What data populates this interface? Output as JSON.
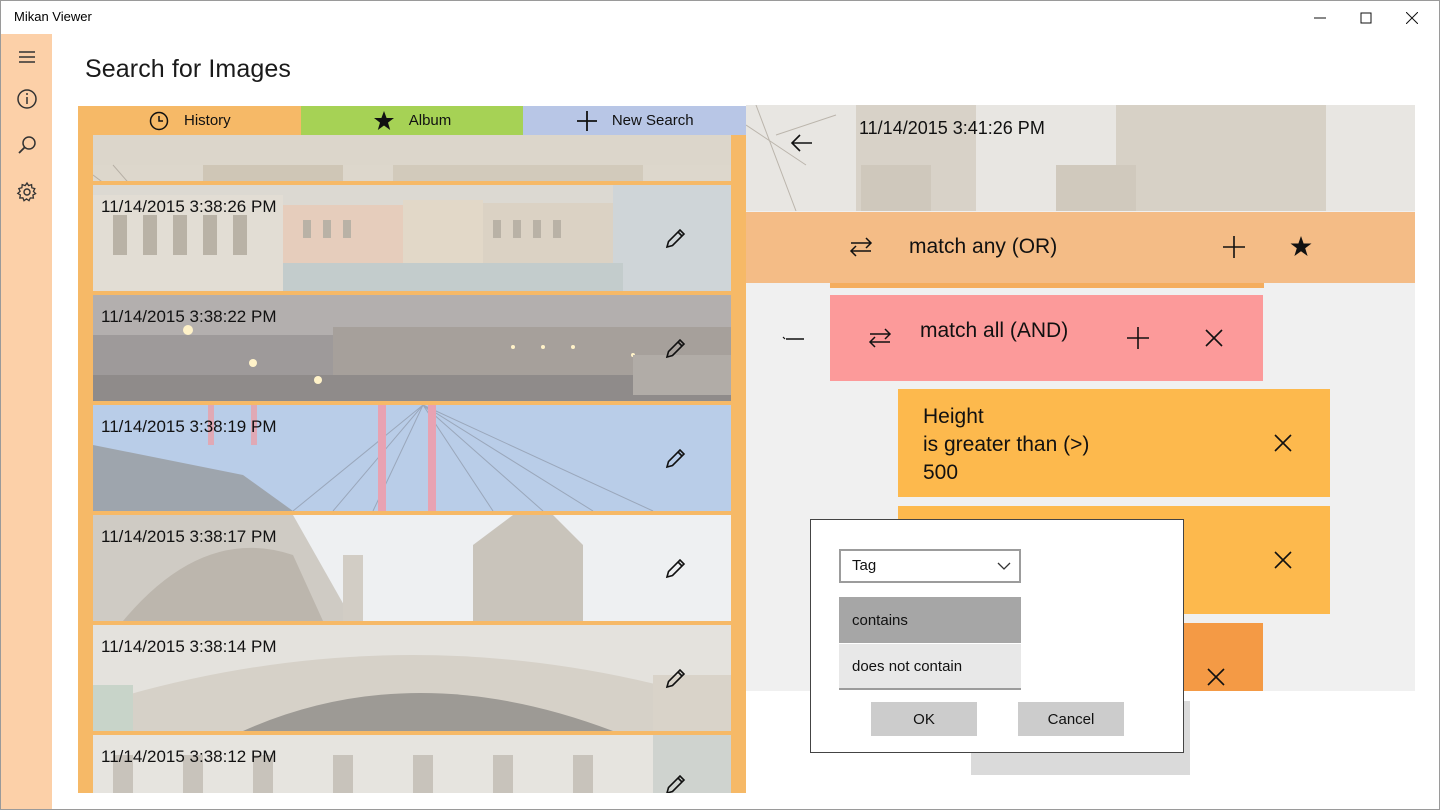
{
  "window": {
    "title": "Mikan Viewer",
    "controls": [
      "minimize",
      "maximize",
      "close"
    ]
  },
  "rail": {
    "items": [
      {
        "icon": "hamburger-icon"
      },
      {
        "icon": "info-icon"
      },
      {
        "icon": "search-icon"
      },
      {
        "icon": "settings-gear-icon"
      }
    ]
  },
  "page": {
    "title": "Search for Images"
  },
  "tabs": [
    {
      "label": "History",
      "icon": "clock-icon",
      "color": "#f6b967"
    },
    {
      "label": "Album",
      "icon": "star-icon",
      "color": "#a6d255"
    },
    {
      "label": "New Search",
      "icon": "plus-icon",
      "color": "#b8c6e6"
    }
  ],
  "history": {
    "items": [
      {
        "timestamp": "11/14/2015 3:38:26 PM",
        "scene": "canal"
      },
      {
        "timestamp": "11/14/2015 3:38:22 PM",
        "scene": "night"
      },
      {
        "timestamp": "11/14/2015 3:38:19 PM",
        "scene": "bridge-cables"
      },
      {
        "timestamp": "11/14/2015 3:38:17 PM",
        "scene": "cathedral"
      },
      {
        "timestamp": "11/14/2015 3:38:14 PM",
        "scene": "arch-bridge"
      },
      {
        "timestamp": "11/14/2015 3:38:12 PM",
        "scene": "facade"
      }
    ]
  },
  "detail": {
    "timestamp": "11/14/2015 3:41:26 PM",
    "or_group": {
      "label": "match any (OR)"
    },
    "and_group": {
      "label": "match all (AND)"
    },
    "conditions": [
      {
        "lines": [
          "Height",
          "is greater than (>)",
          "500"
        ]
      },
      {
        "lines": []
      }
    ]
  },
  "dialog": {
    "field": "Tag",
    "options": [
      {
        "label": "contains",
        "selected": true
      },
      {
        "label": "does not contain",
        "selected": false
      }
    ],
    "ok_label": "OK",
    "cancel_label": "Cancel"
  },
  "colors": {
    "rail": "#fcd0a8",
    "history_bg": "#f6b967",
    "or_bar": "#f4bc86",
    "and_block": "#fc9a9a",
    "condition": "#fdb94d"
  }
}
